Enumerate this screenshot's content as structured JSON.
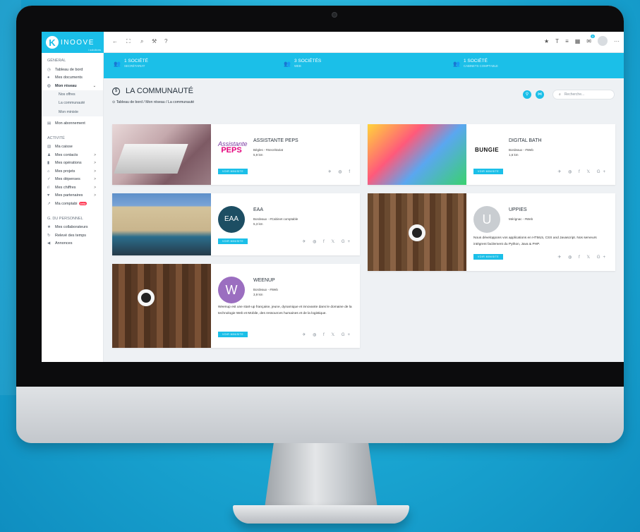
{
  "app": {
    "logo_letter": "K",
    "logo_text": "inoove",
    "logo_sub": "i.solutions"
  },
  "topbar": {
    "back_icon": "←",
    "fullscreen_icon": "⛶",
    "search_icon": "⌕",
    "tools_icon": "⚒",
    "help_icon": "?",
    "right_icons": [
      "★",
      "T",
      "≡",
      "▦"
    ],
    "notif_count": "0",
    "more_icon": "···"
  },
  "sidebar": {
    "general_title": "GÉNÉRAL",
    "general_items": [
      {
        "icon": "◷",
        "label": "Tableau de bord"
      },
      {
        "icon": "●",
        "label": "Mes documents"
      },
      {
        "icon": "◎",
        "label": "Mon réseau",
        "arrow": "⌄"
      }
    ],
    "sub_items": [
      "Nos offres",
      "La communauté",
      "Mon ministe"
    ],
    "subscription": {
      "icon": "▤",
      "label": "Mon abonnement"
    },
    "activity_title": "ACTIVITÉ",
    "activity_items": [
      {
        "icon": "▧",
        "label": "Ma caisse",
        "arrow": ""
      },
      {
        "icon": "♟",
        "label": "Mes contacts",
        "arrow": ">"
      },
      {
        "icon": "▮",
        "label": "Mes opérations",
        "arrow": ">"
      },
      {
        "icon": "⌂",
        "label": "Mes projets",
        "arrow": ">"
      },
      {
        "icon": "✓",
        "label": "Mes dépenses",
        "arrow": ">"
      },
      {
        "icon": "ıl",
        "label": "Mes chiffres",
        "arrow": ">"
      },
      {
        "icon": "♥",
        "label": "Mes partenaires",
        "arrow": ">"
      },
      {
        "icon": "↗",
        "label": "Ma comptabi",
        "badge": "beta"
      }
    ],
    "staff_title": "G. DU PERSONNEL",
    "staff_items": [
      {
        "icon": "★",
        "label": "Mes collaborateurs"
      },
      {
        "icon": "↻",
        "label": "Relevé des temps"
      },
      {
        "icon": "◀",
        "label": "Annonces"
      }
    ]
  },
  "stats": [
    {
      "count": "1 SOCIÉTÉ",
      "label": "SECRÉTARIAT"
    },
    {
      "count": "3 SOCIÉTÉS",
      "label": "WEB"
    },
    {
      "count": "1 SOCIÉTÉ",
      "label": "CABINETS COMPTABLE"
    }
  ],
  "page": {
    "title": "LA COMMUNAUTÉ",
    "breadcrumb": "Tableau de bord / Mon réseau / La communauté",
    "search_placeholder": "Recherche..."
  },
  "cards": [
    {
      "name": "ASSISTANTE PEPS",
      "meta1": "Bègles - #Secrétariat",
      "meta2": "5,9 km",
      "desc": "",
      "btn": "VOIR MINISITE",
      "social": "✈ ◍ f",
      "logo_top": "Assistante",
      "logo_bottom": "PEPS"
    },
    {
      "name": "DIGITAL BATH",
      "meta1": "Bordeaux - #Web",
      "meta2": "1,6 km",
      "desc": "",
      "btn": "VOIR MINISITE",
      "social": "✈ ◍ f 𝕏 G+",
      "logo": "BUNGIE"
    },
    {
      "name": "EAA",
      "meta1": "Bordeaux - #Cabinet comptable",
      "meta2": "5,3 km",
      "desc": "",
      "btn": "VOIR MINISITE",
      "social": "✈ ◍ f 𝕏 G+",
      "logo": "EAA"
    },
    {
      "name": "UPPIES",
      "meta1": "Mérignac - #Web",
      "meta2": "",
      "desc": "Nous développons vos applications en HTML5, CSS and Javascript. Nos serveurs intègrent facilement du Python, Java & PHP.",
      "btn": "VOIR MINISITE",
      "social": "✈ ◍ f 𝕏 G+",
      "logo": "U"
    },
    {
      "name": "WEENUP",
      "meta1": "Bordeaux - #Web",
      "meta2": "3,9 km",
      "desc": "Weenup est une start-up française, jeune, dynamique et innovante dans le domaine de la technologie Web et Mobile, des ressources humaines et de la logistique.",
      "btn": "VOIR MINISITE",
      "social": "✈ ◍ f 𝕏 G+",
      "logo": "W"
    }
  ],
  "colors": {
    "accent": "#1bbfe8",
    "badge": "#ff3b55"
  }
}
